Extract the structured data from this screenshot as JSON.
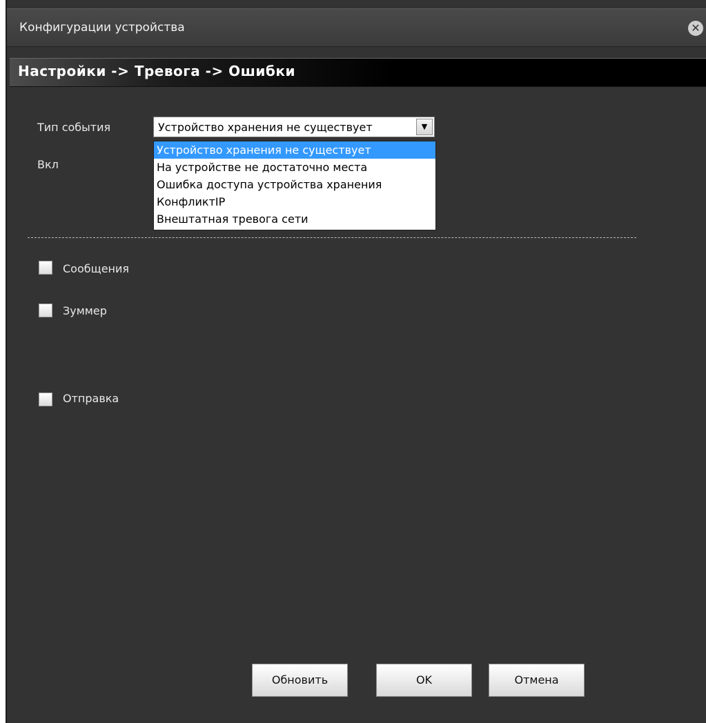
{
  "window": {
    "title": "Конфигурации устройства",
    "close_icon": "close-icon"
  },
  "breadcrumb": "Настройки -> Тревога -> Ошибки",
  "form": {
    "event_type_label": "Тип события",
    "event_type_value": "Устройство хранения не существует",
    "enable_label": "Вкл",
    "dropdown_options": [
      "Устройство хранения не существует",
      "На устройстве не достаточно места",
      "Ошибка доступа устройства хранения",
      "КонфликтIP",
      "Внештатная тревога сети"
    ],
    "selected_index": 0
  },
  "checkboxes": {
    "messages_label": "Сообщения",
    "buzzer_label": "Зуммер",
    "send_label": "Отправка"
  },
  "buttons": {
    "refresh": "Обновить",
    "ok": "OK",
    "cancel": "Отмена"
  },
  "colors": {
    "background": "#333333",
    "selection": "#3399ff"
  }
}
